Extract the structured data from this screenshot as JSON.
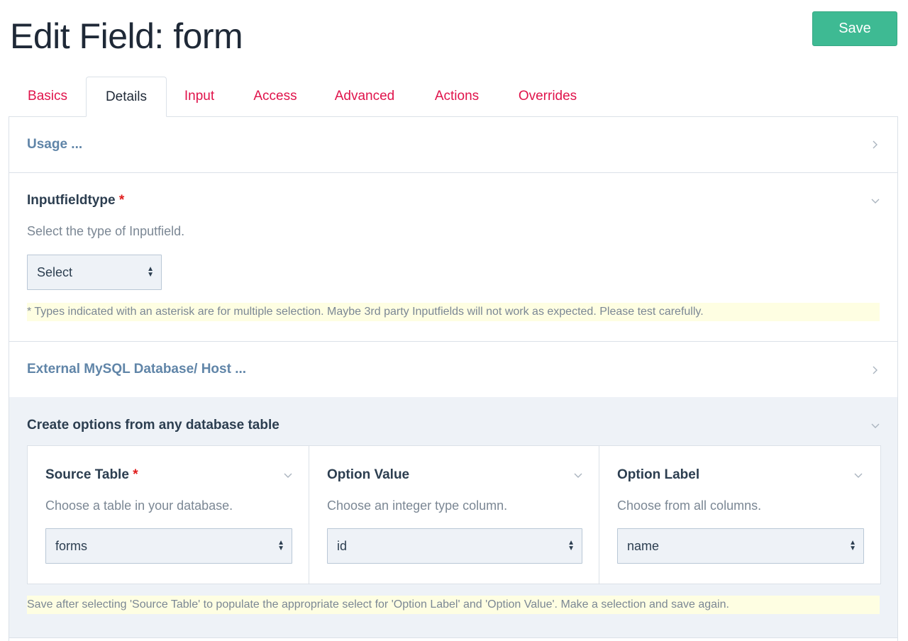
{
  "page": {
    "title": "Edit Field: form",
    "save_label": "Save"
  },
  "tabs": [
    {
      "label": "Basics",
      "active": false
    },
    {
      "label": "Details",
      "active": true
    },
    {
      "label": "Input",
      "active": false
    },
    {
      "label": "Access",
      "active": false
    },
    {
      "label": "Advanced",
      "active": false
    },
    {
      "label": "Actions",
      "active": false
    },
    {
      "label": "Overrides",
      "active": false
    }
  ],
  "sections": {
    "usage": {
      "label": "Usage ...",
      "expanded": false
    },
    "inputfieldtype": {
      "label": "Inputfieldtype",
      "required_marker": "*",
      "description": "Select the type of Inputfield.",
      "select_value": "Select",
      "note": "* Types indicated with an asterisk are for multiple selection. Maybe 3rd party Inputfields will not work as expected. Please test carefully."
    },
    "external_db": {
      "label": "External MySQL Database/ Host ...",
      "expanded": false
    },
    "create_options": {
      "label": "Create options from any database table",
      "columns": [
        {
          "label": "Source Table",
          "required_marker": "*",
          "description": "Choose a table in your database.",
          "value": "forms"
        },
        {
          "label": "Option Value",
          "required_marker": "",
          "description": "Choose an integer type column.",
          "value": "id"
        },
        {
          "label": "Option Label",
          "required_marker": "",
          "description": "Choose from all columns.",
          "value": "name"
        }
      ],
      "note": "Save after selecting 'Source Table' to populate the appropriate select for 'Option Label' and 'Option Value'. Make a selection and save again."
    }
  },
  "colors": {
    "accent_green": "#3eba93",
    "tab_link": "#e0134b",
    "collapsed_heading": "#6085a8",
    "required": "#e01c1c",
    "note_bg": "#fefee2"
  }
}
